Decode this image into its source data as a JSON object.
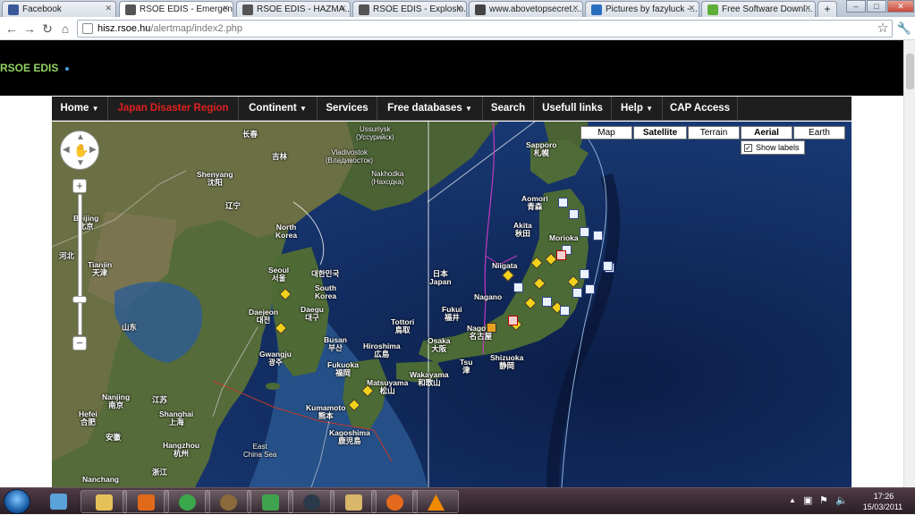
{
  "tabs": [
    {
      "title": "Facebook",
      "favicon_color": "#3b5998",
      "active": false
    },
    {
      "title": "RSOE EDIS - Emergen...",
      "favicon_color": "#555555",
      "active": true
    },
    {
      "title": "RSOE EDIS - HAZMA...",
      "favicon_color": "#555555",
      "active": false
    },
    {
      "title": "RSOE EDIS - Explosio...",
      "favicon_color": "#555555",
      "active": false
    },
    {
      "title": "www.abovetopsecret....",
      "favicon_color": "#444444",
      "active": false
    },
    {
      "title": "Pictures by fazyluck -...",
      "favicon_color": "#2a6fbf",
      "active": false
    },
    {
      "title": "Free Software Downl...",
      "favicon_color": "#5fae3a",
      "active": false
    }
  ],
  "window_controls": {
    "minimize": "–",
    "maximize": "□",
    "close": "✕"
  },
  "toolbar": {
    "back_icon": "arrow-left",
    "forward_icon": "arrow-right",
    "reload_icon": "reload",
    "home_icon": "home",
    "url_host": "hisz.rsoe.hu",
    "url_path": "/alertmap/index2.php",
    "star_icon": "star",
    "wrench_icon": "wrench"
  },
  "site": {
    "title": "RSOE EDIS",
    "title_color": "#8fd35f"
  },
  "nav": [
    {
      "label": "Home",
      "dropdown": true
    },
    {
      "label": "Japan Disaster Region",
      "dropdown": false,
      "highlight": "#e02020"
    },
    {
      "label": "Continent",
      "dropdown": true
    },
    {
      "label": "Services",
      "dropdown": false
    },
    {
      "label": "Free databases",
      "dropdown": true
    },
    {
      "label": "Search",
      "dropdown": false
    },
    {
      "label": "Usefull links",
      "dropdown": false
    },
    {
      "label": "Help",
      "dropdown": true
    },
    {
      "label": "CAP Access",
      "dropdown": false
    }
  ],
  "map": {
    "map_types": [
      "Map",
      "Satellite",
      "Terrain",
      "Aerial",
      "Earth"
    ],
    "selected_types": [
      "Satellite",
      "Aerial"
    ],
    "show_labels": {
      "label": "Show labels",
      "checked": true
    },
    "zoom_in": "+",
    "zoom_out": "−",
    "labels": [
      {
        "name": "Sapporo",
        "sub": "札幌"
      },
      {
        "name": "Ussuriysk",
        "sub": "(Уссурийск)"
      },
      {
        "name": "Vladivostok",
        "sub": "(Владивосток)"
      },
      {
        "name": "Nakhodka",
        "sub": "(Находка)"
      },
      {
        "name": "长春",
        "sub": ""
      },
      {
        "name": "吉林",
        "sub": ""
      },
      {
        "name": "Shenyang",
        "sub": "沈阳"
      },
      {
        "name": "Beijing",
        "sub": "北京"
      },
      {
        "name": "Tianjin",
        "sub": "天津"
      },
      {
        "name": "河北",
        "sub": ""
      },
      {
        "name": "山东",
        "sub": ""
      },
      {
        "name": "North",
        "sub": "Korea"
      },
      {
        "name": "Seoul",
        "sub": "서울"
      },
      {
        "name": "대한민국",
        "sub": ""
      },
      {
        "name": "South",
        "sub": "Korea"
      },
      {
        "name": "Daegu",
        "sub": "대구"
      },
      {
        "name": "Daejeon",
        "sub": "대전"
      },
      {
        "name": "Busan",
        "sub": "부산"
      },
      {
        "name": "Gwangju",
        "sub": "광주"
      },
      {
        "name": "Aomori",
        "sub": "青森"
      },
      {
        "name": "Akita",
        "sub": "秋田"
      },
      {
        "name": "Morioka",
        "sub": ""
      },
      {
        "name": "Niigata",
        "sub": ""
      },
      {
        "name": "日本",
        "sub": "Japan"
      },
      {
        "name": "Nagano",
        "sub": ""
      },
      {
        "name": "Fukui",
        "sub": "福井"
      },
      {
        "name": "Tottori",
        "sub": "鳥取"
      },
      {
        "name": "Hiroshima",
        "sub": "広島"
      },
      {
        "name": "Osaka",
        "sub": "大阪"
      },
      {
        "name": "Nagoya",
        "sub": "名古屋"
      },
      {
        "name": "Tsu",
        "sub": "津"
      },
      {
        "name": "Shizuoka",
        "sub": "静岡"
      },
      {
        "name": "Fukuoka",
        "sub": "福岡"
      },
      {
        "name": "Matsuyama",
        "sub": "松山"
      },
      {
        "name": "Wakayama",
        "sub": "和歌山"
      },
      {
        "name": "Kumamoto",
        "sub": "熊本"
      },
      {
        "name": "Kagoshima",
        "sub": "鹿児島"
      },
      {
        "name": "East",
        "sub": "China Sea"
      },
      {
        "name": "Nanjing",
        "sub": "南京"
      },
      {
        "name": "江苏",
        "sub": ""
      },
      {
        "name": "Hefei",
        "sub": "合肥"
      },
      {
        "name": "Shanghai",
        "sub": "上海"
      },
      {
        "name": "安徽",
        "sub": ""
      },
      {
        "name": "Hangzhou",
        "sub": "杭州"
      },
      {
        "name": "浙江",
        "sub": ""
      },
      {
        "name": "Nanchang",
        "sub": ""
      },
      {
        "name": "辽宁",
        "sub": ""
      }
    ]
  },
  "taskbar": {
    "apps": [
      {
        "name": "windows-mail",
        "color": "#5aa3d8"
      },
      {
        "name": "windows-explorer",
        "color": "#e6c15a"
      },
      {
        "name": "media-player",
        "color": "#e06a1a"
      },
      {
        "name": "chrome",
        "color": "#3aa84b"
      },
      {
        "name": "onion-app",
        "color": "#8a6a3a"
      },
      {
        "name": "messenger",
        "color": "#3fa34d"
      },
      {
        "name": "steam",
        "color": "#2b3a4a"
      },
      {
        "name": "paint",
        "color": "#d8b66a"
      },
      {
        "name": "firefox",
        "color": "#e36a1c"
      },
      {
        "name": "vlc",
        "color": "#f08a00"
      }
    ],
    "time": "17:26",
    "date": "15/03/2011"
  }
}
